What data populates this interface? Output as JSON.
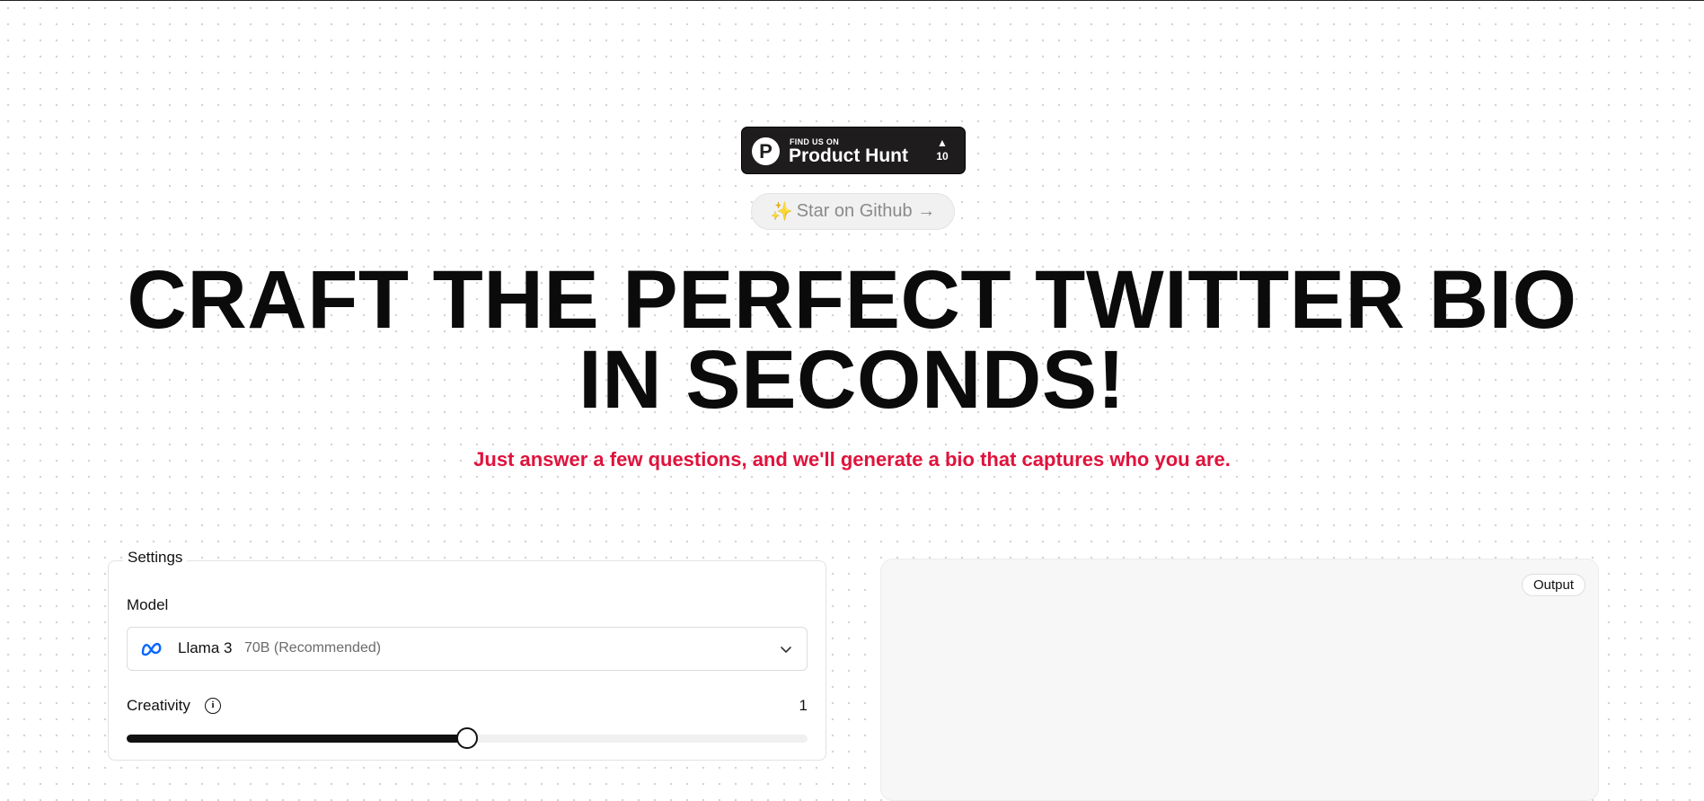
{
  "badges": {
    "producthunt": {
      "find_us": "FIND US ON",
      "name": "Product Hunt",
      "logo_letter": "P",
      "arrow": "▲",
      "votes": "10"
    },
    "github": {
      "sparkle": "✨",
      "label": "Star on Github →"
    }
  },
  "hero": {
    "title_line1": "CRAFT THE PERFECT TWITTER BIO",
    "title_line2": "IN SECONDS!",
    "subtitle": "Just answer a few questions, and we'll generate a bio that captures who you are.",
    "subtitle_color": "#e0123c"
  },
  "settings": {
    "legend": "Settings",
    "model_label": "Model",
    "model_name": "Llama 3",
    "model_variant": "70B (Recommended)",
    "model_icon": "meta-logo-icon",
    "creativity_label": "Creativity",
    "creativity_info": "i",
    "creativity_value": "1",
    "creativity_fraction": 0.5
  },
  "output": {
    "badge": "Output"
  }
}
